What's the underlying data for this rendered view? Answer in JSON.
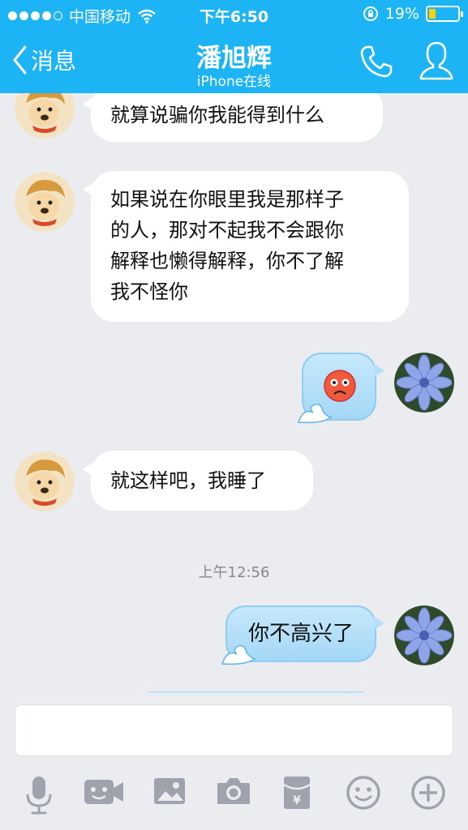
{
  "status_bar": {
    "carrier": "中国移动",
    "time": "下午6:50",
    "battery": "19%",
    "battery_level": 0.19
  },
  "nav": {
    "back_label": "消息",
    "contact_name": "潘旭辉",
    "contact_status": "iPhone在线"
  },
  "messages": [
    {
      "side": "in",
      "text": "就算说骗你我能得到什么"
    },
    {
      "side": "in",
      "lines": [
        "如果说在你眼里我是那样子",
        "的人，那对不起我不会跟你",
        "解释也懒得解释，你不了解",
        "我不怪你"
      ]
    },
    {
      "side": "out",
      "type": "emoji",
      "emoji": "sad-face"
    },
    {
      "side": "in",
      "text": "就这样吧，我睡了"
    },
    {
      "side": "out",
      "text": "你不高兴了"
    }
  ],
  "timestamp": "上午12:56",
  "colors": {
    "header": "#1cb4f4",
    "background": "#ebecf0",
    "bubble_out": "#a4d8f7"
  },
  "toolbar_icons": [
    "microphone-icon",
    "video-call-icon",
    "image-icon",
    "camera-icon",
    "red-packet-icon",
    "emoji-icon",
    "plus-icon"
  ]
}
